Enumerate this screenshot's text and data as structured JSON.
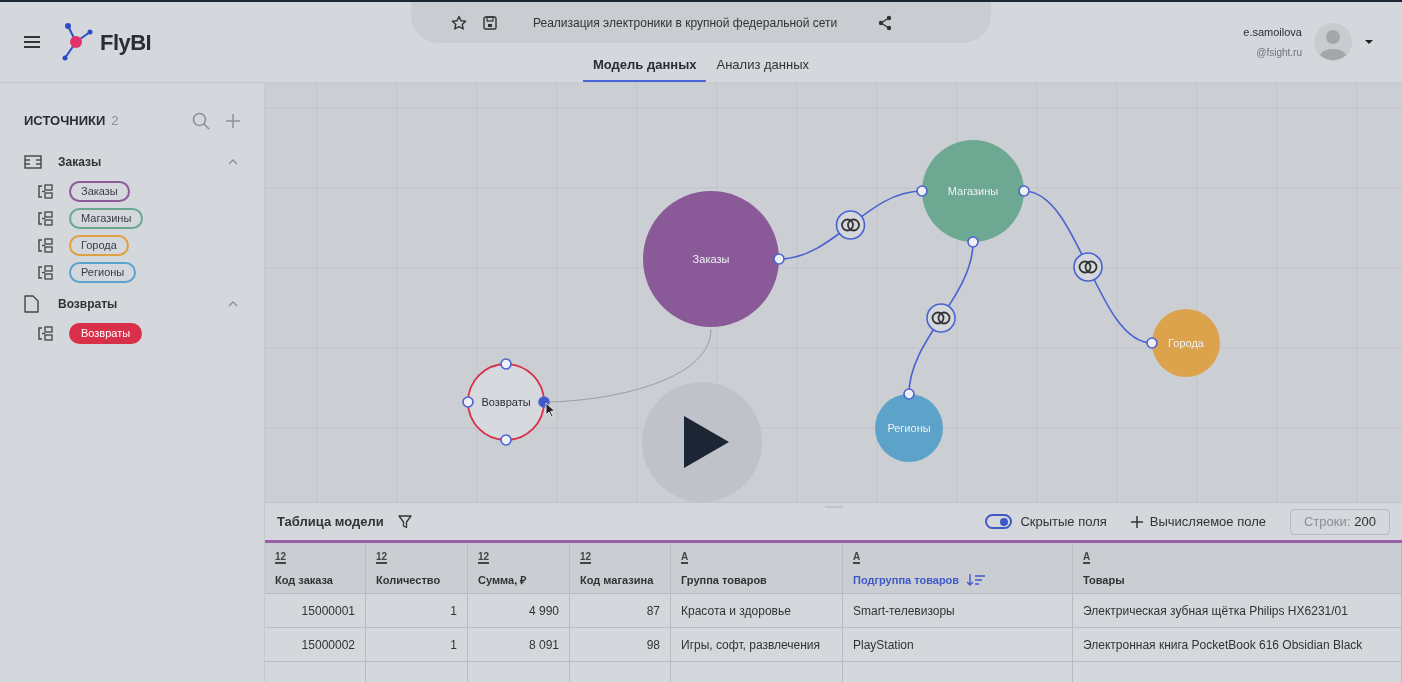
{
  "header": {
    "app_name": "FlyBI",
    "document_title": "Реализация электроники в крупной федеральной сети",
    "tabs": [
      {
        "label": "Модель данных",
        "selected": true
      },
      {
        "label": "Анализ данных",
        "selected": false
      }
    ],
    "user": {
      "name": "e.samoilova",
      "domain": "@fsight.ru"
    }
  },
  "sidebar": {
    "title": "ИСТОЧНИКИ",
    "count": "2",
    "groups": [
      {
        "label": "Заказы",
        "kind": "database",
        "expanded": true,
        "children": [
          {
            "label": "Заказы",
            "color": "#8e5a9c",
            "selected": false
          },
          {
            "label": "Магазины",
            "color": "#6aa88f",
            "selected": false
          },
          {
            "label": "Города",
            "color": "#e0a040",
            "selected": false
          },
          {
            "label": "Регионы",
            "color": "#5aa3cf",
            "selected": false
          }
        ]
      },
      {
        "label": "Возвраты",
        "kind": "file",
        "expanded": true,
        "children": [
          {
            "label": "Возвраты",
            "color": "#d9304a",
            "selected": true
          }
        ]
      }
    ]
  },
  "canvas": {
    "nodes": [
      {
        "label": "Заказы",
        "color": "#8a5a98",
        "selected": false
      },
      {
        "label": "Магазины",
        "color": "#6da892",
        "selected": false
      },
      {
        "label": "Города",
        "color": "#dca24c",
        "selected": false
      },
      {
        "label": "Регионы",
        "color": "#5da2c9",
        "selected": false
      },
      {
        "label": "Возвраты",
        "color": "#d9304a",
        "selected": true
      }
    ],
    "links": [
      {
        "kind": "join"
      },
      {
        "kind": "join"
      },
      {
        "kind": "join"
      },
      {
        "kind": "pending"
      }
    ]
  },
  "table_panel": {
    "title": "Таблица модели",
    "hidden_fields": {
      "label": "Скрытые поля",
      "on": true
    },
    "computed_field": "Вычисляемое поле",
    "rows_field": {
      "label": "Строки:",
      "value": "200"
    },
    "columns": [
      {
        "type": "12",
        "label": "Код заказа",
        "sorted": false
      },
      {
        "type": "12",
        "label": "Количество",
        "sorted": false
      },
      {
        "type": "12",
        "label": "Сумма, ₽",
        "sorted": false
      },
      {
        "type": "12",
        "label": "Код магазина",
        "sorted": false
      },
      {
        "type": "A",
        "label": "Группа товаров",
        "sorted": false
      },
      {
        "type": "A",
        "label": "Подгруппа товаров",
        "sorted": true
      },
      {
        "type": "A",
        "label": "Товары",
        "sorted": false
      }
    ],
    "rows": [
      [
        "15000001",
        "1",
        "4 990",
        "87",
        "Красота и здоровье",
        "Smart-телевизоры",
        "Электрическая зубная щётка Philips HX6231/01"
      ],
      [
        "15000002",
        "1",
        "8 091",
        "98",
        "Игры, софт, развлечения",
        "PlayStation",
        "Электронная книга PocketBook 616 Obsidian Black"
      ]
    ]
  }
}
